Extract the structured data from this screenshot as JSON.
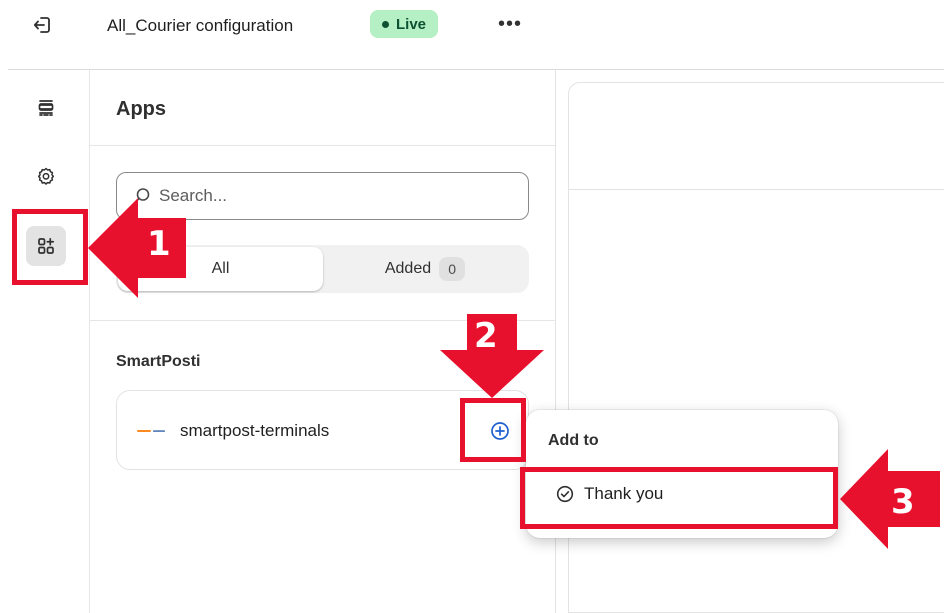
{
  "topbar": {
    "title": "All_Courier configuration",
    "live_label": "Live",
    "more_label": "•••",
    "exit_icon": "exit-icon"
  },
  "rail": {
    "items": [
      {
        "icon": "sections-icon"
      },
      {
        "icon": "gear-icon"
      },
      {
        "icon": "apps-icon",
        "active": true
      }
    ]
  },
  "apps_panel": {
    "title": "Apps",
    "search_placeholder": "Search...",
    "tabs": [
      {
        "label": "All",
        "selected": true
      },
      {
        "label": "Added",
        "count": "0"
      }
    ],
    "groups": [
      {
        "label": "SmartPosti",
        "apps": [
          {
            "name": "smartpost-terminals",
            "logo": "smartpost-logo",
            "action_icon": "plus-circle-icon"
          }
        ]
      }
    ]
  },
  "popover": {
    "title": "Add to",
    "items": [
      {
        "label": "Thank you",
        "icon": "check-circle-icon"
      }
    ]
  },
  "annotations": [
    {
      "number": "1"
    },
    {
      "number": "2"
    },
    {
      "number": "3"
    }
  ],
  "colors": {
    "annotation": "#e8112d",
    "live_bg": "#b5f0c4",
    "live_text": "#0c5132",
    "accent_blue": "#1f5fcf"
  }
}
